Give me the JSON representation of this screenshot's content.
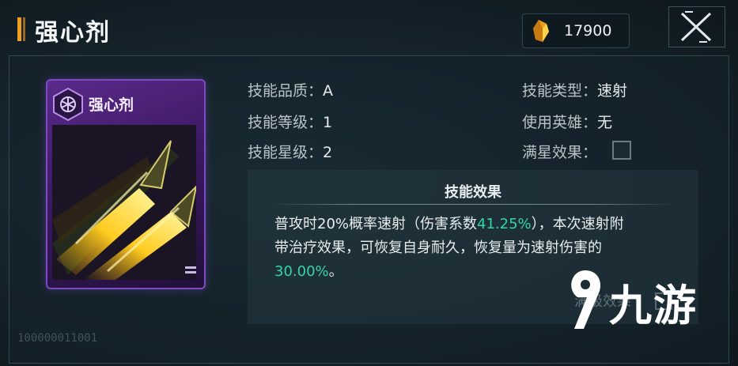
{
  "header": {
    "title": "强心剂",
    "currency": {
      "icon": "crystal-icon",
      "value": "17900"
    },
    "close_icon": "close-icon"
  },
  "card": {
    "name": "强心剂",
    "icon": "skill-hex-icon",
    "art": "rockets-art"
  },
  "attributes": {
    "quality_label": "技能品质：",
    "quality_value": "A",
    "level_label": "技能等级：",
    "level_value": "1",
    "star_label": "技能星级：",
    "star_value": "2",
    "type_label": "技能类型：",
    "type_value": "速射",
    "hero_label": "使用英雄：",
    "hero_value": "无",
    "maxstar_label": "满星效果："
  },
  "effect": {
    "title": "技能效果",
    "line1_a": "普攻时20%概率速射（伤害系数",
    "line1_pct": "41.25%",
    "line1_b": "），本次速射附",
    "line2": "带治疗效果，可恢复自身耐久，恢复量为速射伤害的",
    "line3_pct": "30.00%",
    "line3_end": "。",
    "footer": "满级效果"
  },
  "watermark": {
    "text": "九游"
  },
  "bottom_code": "100000011001",
  "colors": {
    "accent": "#f0a020",
    "highlight": "#33d6a6",
    "card_purple": "#7c4bc0"
  }
}
